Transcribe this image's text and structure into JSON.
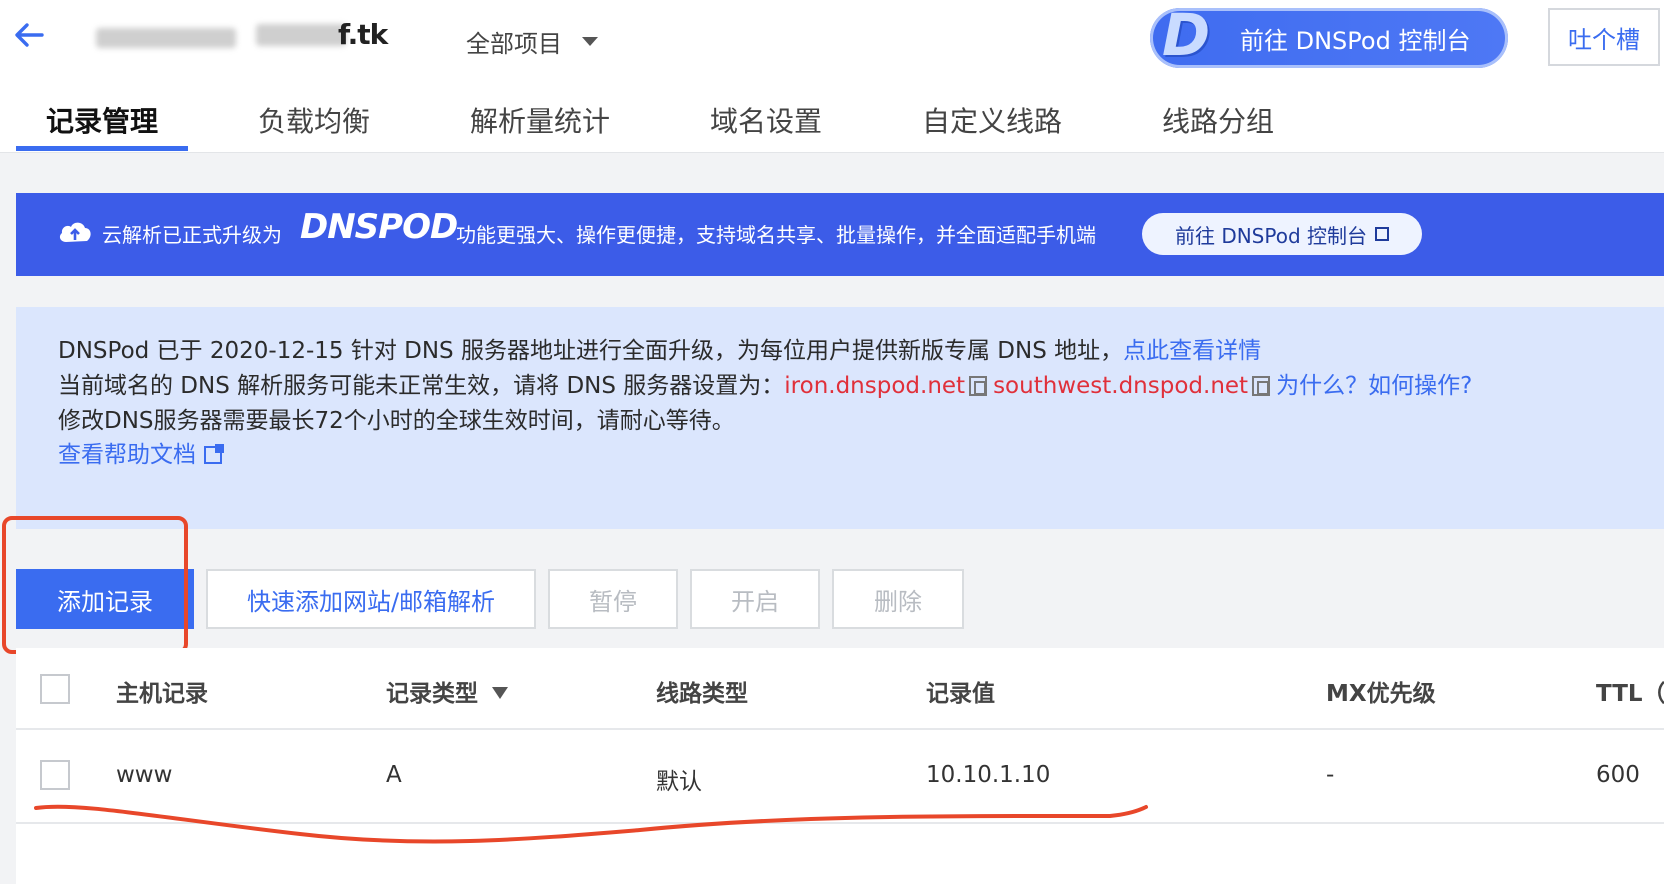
{
  "header": {
    "domain_suffix": "f.tk",
    "project_select": "全部项目",
    "dnspod_button": "前往 DNSPod 控制台",
    "feedback_button": "吐个槽"
  },
  "tabs": [
    {
      "label": "记录管理",
      "active": true
    },
    {
      "label": "负载均衡"
    },
    {
      "label": "解析量统计"
    },
    {
      "label": "域名设置"
    },
    {
      "label": "自定义线路"
    },
    {
      "label": "线路分组"
    }
  ],
  "promo": {
    "text1": "云解析已正式升级为",
    "brand": "DNSPOD",
    "text2": "功能更强大、操作更便捷，支持域名共享、批量操作，并全面适配手机端",
    "button": "前往 DNSPod 控制台"
  },
  "notice": {
    "line1": "DNSPod 已于 2020-12-15 针对 DNS 服务器地址进行全面升级，为每位用户提供新版专属 DNS 地址，",
    "line1_link": "点此查看详情",
    "line2": "当前域名的 DNS 解析服务可能未正常生效，请将 DNS 服务器设置为：",
    "ns1": "iron.dnspod.net",
    "ns2": "southwest.dnspod.net",
    "line2_link": "为什么？如何操作?",
    "line3": "修改DNS服务器需要最长72个小时的全球生效时间，请耐心等待。",
    "help_link": "查看帮助文档"
  },
  "toolbar": {
    "add": "添加记录",
    "quick_add": "快速添加网站/邮箱解析",
    "pause": "暂停",
    "enable": "开启",
    "delete": "删除"
  },
  "table": {
    "columns": [
      "主机记录",
      "记录类型",
      "线路类型",
      "记录值",
      "MX优先级",
      "TTL（"
    ],
    "rows": [
      {
        "host": "www",
        "type": "A",
        "line": "默认",
        "value": "10.10.1.10",
        "mx": "-",
        "ttl": "600"
      }
    ]
  },
  "colors": {
    "accent": "#3a6cf0",
    "promo_bg": "#3c5ce8",
    "notice_bg": "#dbe6fd",
    "annotation": "#e8472a"
  }
}
